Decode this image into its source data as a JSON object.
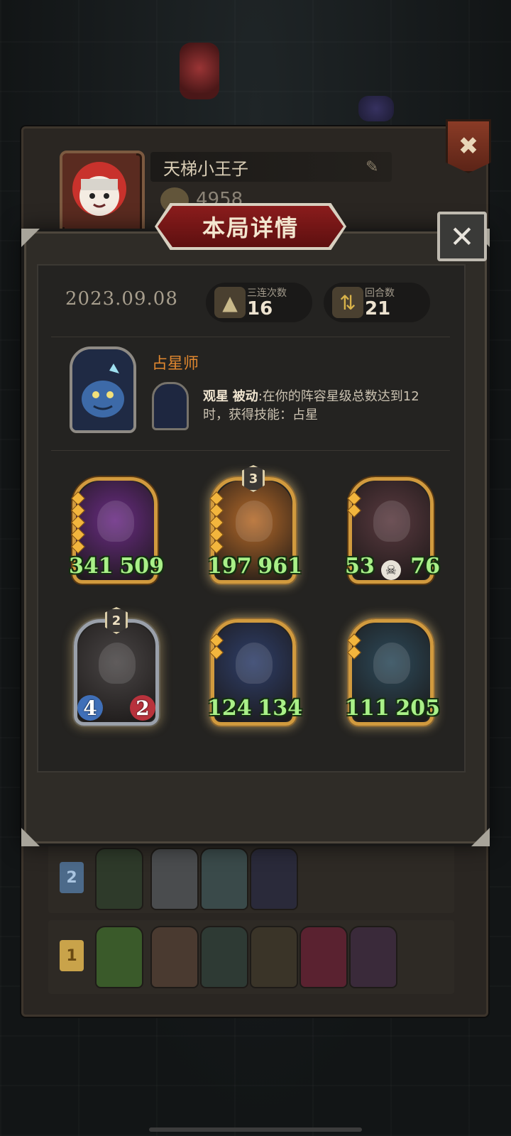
{
  "profile": {
    "player_name": "天梯小王子",
    "score": "4958"
  },
  "modal": {
    "title": "本局详情",
    "date": "2023.09.08",
    "stats": [
      {
        "label": "三连次数",
        "value": "16",
        "icon": "triple-merge-icon"
      },
      {
        "label": "回合数",
        "value": "21",
        "icon": "rounds-cycle-icon"
      }
    ],
    "hero": {
      "name": "占星师",
      "skill_name": "观星",
      "skill_type": "被动",
      "skill_desc": ":在你的阵容星级总数达到12时，获得技能：占星"
    },
    "units": [
      {
        "name": "wooden-totem-unit",
        "atk": "341",
        "hp": "509",
        "star": "",
        "frame": "gold",
        "bg": "#6a2c84",
        "gems": 5
      },
      {
        "name": "dwarf-warrior-unit",
        "atk": "197",
        "hp": "961",
        "star": "3",
        "frame": "gold",
        "bg": "#b46a2a",
        "gems": 5
      },
      {
        "name": "demon-girl-unit",
        "atk": "53",
        "hp": "76",
        "star": "",
        "frame": "gold",
        "bg": "#5a3a40",
        "gems": 2
      },
      {
        "name": "shield-knight-unit",
        "atk": "4",
        "hp": "2",
        "star": "2",
        "frame": "silver",
        "bg": "#4a4646",
        "gems": 0
      },
      {
        "name": "paladin-unit",
        "atk": "124",
        "hp": "134",
        "star": "",
        "frame": "gold",
        "bg": "#2f3f6a",
        "gems": 2
      },
      {
        "name": "ice-elf-unit",
        "atk": "111",
        "hp": "205",
        "star": "",
        "frame": "gold",
        "bg": "#2d4a5a",
        "gems": 2
      }
    ]
  },
  "history": [
    {
      "rank": "2",
      "portraits": 4
    },
    {
      "rank": "1",
      "portraits": 6
    }
  ],
  "colors": {
    "stat_green": "#a9f088",
    "hero_name": "#e0872f",
    "title_red": "#8a1c1c"
  }
}
